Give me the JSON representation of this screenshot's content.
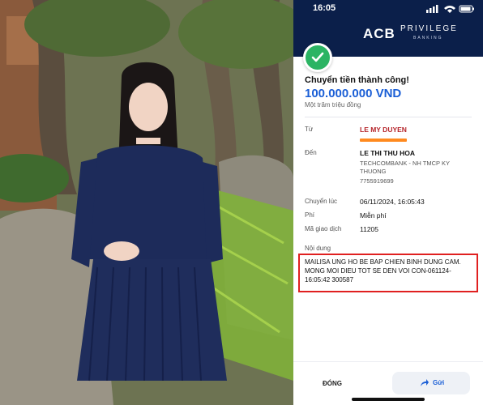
{
  "status_bar": {
    "time": "16:05"
  },
  "brand": {
    "name": "ACB",
    "tier": "PRIVILEGE",
    "subline": "BANKING"
  },
  "transfer": {
    "success_title": "Chuyển tiền thành công!",
    "amount": "100.000.000 VND",
    "amount_in_words": "Một trăm triệu đồng"
  },
  "details": {
    "from_label": "Từ",
    "from_name": "LE MY DUYEN",
    "to_label": "Đến",
    "to_name": "LE THI THU HOA",
    "to_bank": "TECHCOMBANK - NH TMCP KY THUONG",
    "to_account": "7755919699",
    "time_label": "Chuyển lúc",
    "time_value": "06/11/2024, 16:05:43",
    "fee_label": "Phí",
    "fee_value": "Miễn phí",
    "txn_label": "Mã giao dịch",
    "txn_value": "11205",
    "content_label": "Nội dung",
    "content_value": "MAILISA UNG HO BE BAP CHIEN BINH DUNG CAM. MONG MOI DIEU TOT SE DEN VOI CON-061124-16:05:42 300587"
  },
  "actions": {
    "close": "ĐÓNG",
    "send": "Gửi"
  },
  "colors": {
    "header": "#0b1f4a",
    "amount": "#1b5fd6",
    "success": "#2bb463",
    "highlight": "#e02020"
  }
}
